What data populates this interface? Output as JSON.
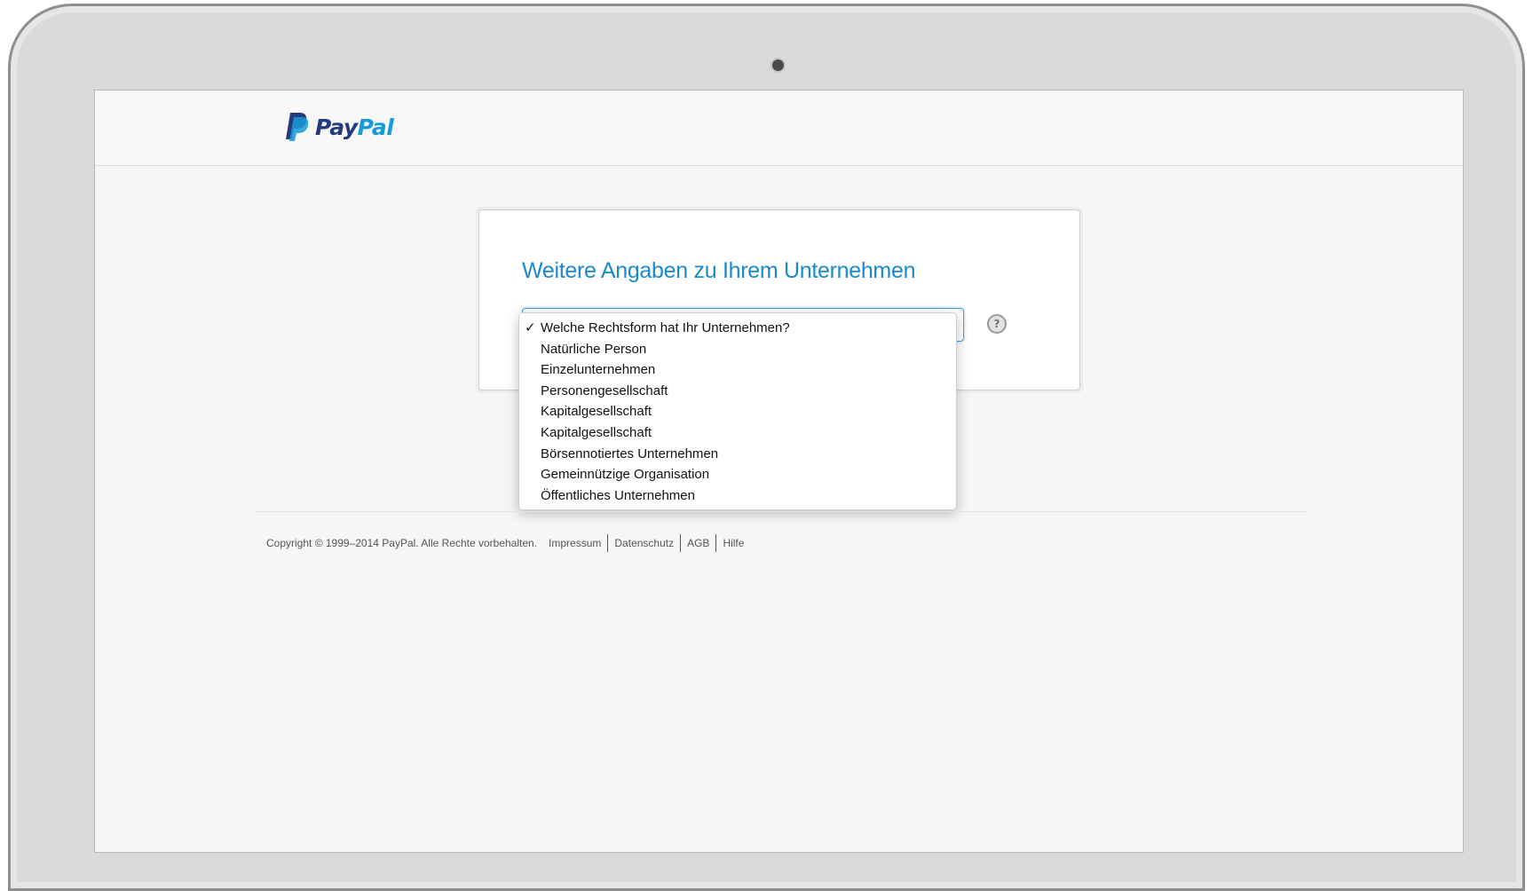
{
  "brand": {
    "logo_word_pay": "Pay",
    "logo_word_pal": "Pal",
    "dark_blue": "#253b80",
    "light_blue": "#179bd7"
  },
  "form": {
    "heading": "Weitere Angaben zu Ihrem Unternehmen",
    "help_icon_glyph": "?",
    "accent_color": "#1a8acb"
  },
  "dropdown": {
    "selected_check": "✓",
    "options": [
      "Welche Rechtsform hat Ihr Unternehmen?",
      "Natürliche Person",
      "Einzelunternehmen",
      "Personengesellschaft",
      "Kapitalgesellschaft",
      "Kapitalgesellschaft",
      "Börsennotiertes Unternehmen",
      "Gemeinnützige Organisation",
      "Öffentliches Unternehmen"
    ]
  },
  "footer": {
    "copyright": "Copyright © 1999–2014 PayPal. Alle Rechte vorbehalten.",
    "links": [
      "Impressum",
      "Datenschutz",
      "AGB",
      "Hilfe"
    ]
  }
}
